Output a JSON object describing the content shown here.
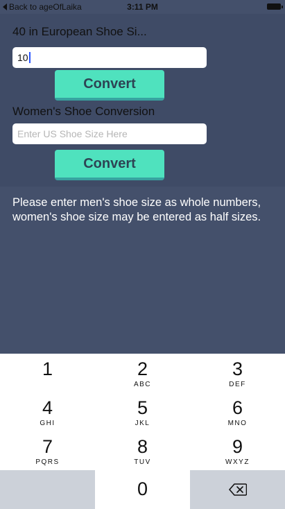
{
  "status_bar": {
    "back_label": "Back to ageOfLaika",
    "time": "3:11 PM"
  },
  "european": {
    "title": "40 in European Shoe Si...",
    "input_value": "10",
    "convert_label": "Convert"
  },
  "women": {
    "title": "Women's Shoe Conversion",
    "placeholder": "Enter US Shoe Size Here",
    "convert_label": "Convert"
  },
  "message": "Please enter men's shoe size as whole numbers, women's shoe size may be entered as half sizes.",
  "keypad": {
    "keys": [
      {
        "digit": "1",
        "letters": ""
      },
      {
        "digit": "2",
        "letters": "ABC"
      },
      {
        "digit": "3",
        "letters": "DEF"
      },
      {
        "digit": "4",
        "letters": "GHI"
      },
      {
        "digit": "5",
        "letters": "JKL"
      },
      {
        "digit": "6",
        "letters": "MNO"
      },
      {
        "digit": "7",
        "letters": "PQRS"
      },
      {
        "digit": "8",
        "letters": "TUV"
      },
      {
        "digit": "9",
        "letters": "WXYZ"
      },
      {
        "digit": "0",
        "letters": ""
      }
    ],
    "delete_icon": "backspace-icon"
  },
  "colors": {
    "background": "#44506b",
    "top_section": "#3f4b66",
    "button": "#4fe2be",
    "button_text": "#2d4454",
    "key_gray": "#ccd1d9"
  }
}
